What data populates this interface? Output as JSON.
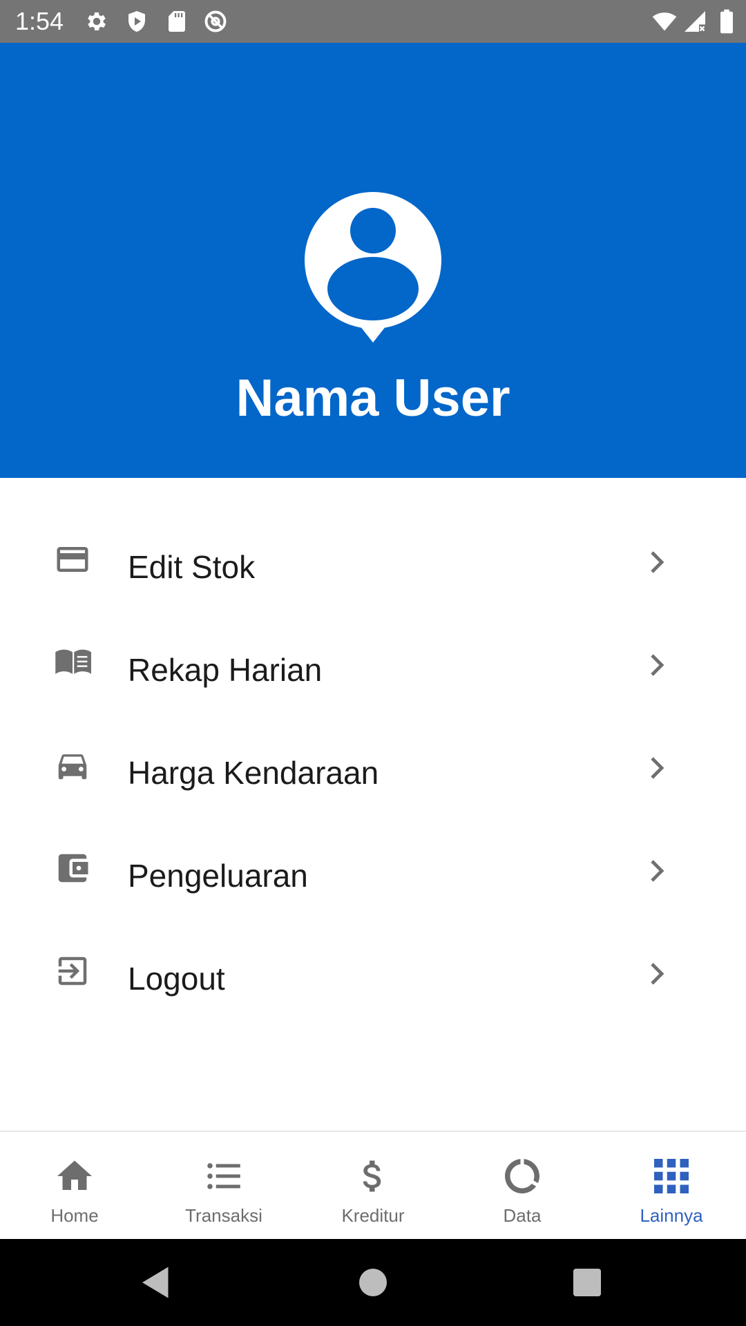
{
  "status_bar": {
    "time": "1:54",
    "left_icons": [
      "gear-icon",
      "shield-icon",
      "sd-card-icon",
      "at-sign-icon"
    ],
    "right_icons": [
      "wifi-icon",
      "signal-icon",
      "battery-icon"
    ]
  },
  "header": {
    "user_name": "Nama User",
    "background": "#0366c9"
  },
  "menu": {
    "items": [
      {
        "label": "Edit Stok",
        "icon": "card-icon"
      },
      {
        "label": "Rekap Harian",
        "icon": "book-icon"
      },
      {
        "label": "Harga Kendaraan",
        "icon": "car-icon"
      },
      {
        "label": "Pengeluaran",
        "icon": "wallet-icon"
      },
      {
        "label": "Logout",
        "icon": "logout-icon"
      }
    ]
  },
  "bottom_nav": {
    "active": "Lainnya",
    "active_color": "#2f61bf",
    "inactive_color": "#6d6d6d",
    "items": [
      {
        "label": "Home",
        "icon": "home-icon"
      },
      {
        "label": "Transaksi",
        "icon": "list-icon"
      },
      {
        "label": "Kreditur",
        "icon": "dollar-icon"
      },
      {
        "label": "Data",
        "icon": "donut-chart-icon"
      },
      {
        "label": "Lainnya",
        "icon": "grid-icon"
      }
    ]
  }
}
